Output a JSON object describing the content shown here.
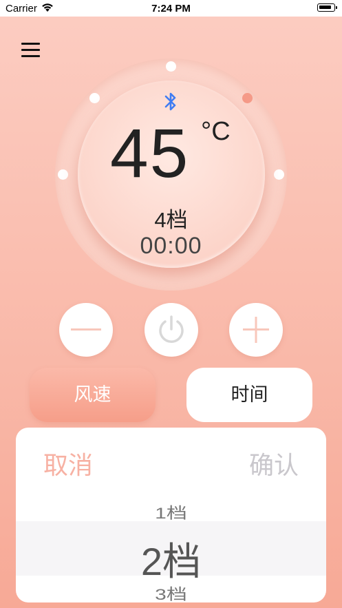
{
  "status_bar": {
    "carrier": "Carrier",
    "time": "7:24 PM"
  },
  "icons": {
    "menu": "hamburger-menu-icon",
    "bluetooth": "bluetooth-icon",
    "minus": "minus-icon",
    "power": "power-icon",
    "plus": "plus-icon"
  },
  "colors": {
    "background_top": "#fccdc2",
    "background_bottom": "#f7a996",
    "accent": "#f59a88",
    "bluetooth": "#3f7cf2",
    "cancel_text": "#f7b1a3",
    "confirm_text": "#c9c7cc"
  },
  "display": {
    "temperature": "45",
    "unit": "°C",
    "gear": "4档",
    "timer": "00:00"
  },
  "mode_buttons": {
    "fan_speed": "风速",
    "time": "时间"
  },
  "picker": {
    "cancel": "取消",
    "confirm": "确认",
    "options": [
      "1档",
      "2档",
      "3档"
    ],
    "selected": "2档"
  }
}
